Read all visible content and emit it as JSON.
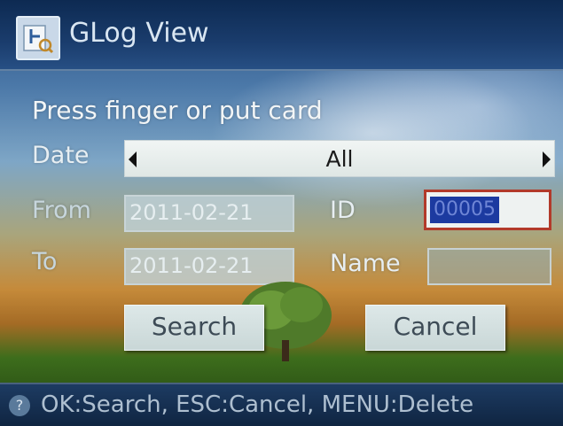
{
  "header": {
    "title": "GLog View",
    "icon": "finger-log-icon"
  },
  "form": {
    "instruction": "Press finger or put card",
    "date_label": "Date",
    "date_value": "All",
    "from_label": "From",
    "from_value": "2011-02-21",
    "to_label": "To",
    "to_value": "2011-02-21",
    "id_label": "ID",
    "id_value": "00005",
    "name_label": "Name",
    "name_value": ""
  },
  "buttons": {
    "search": "Search",
    "cancel": "Cancel"
  },
  "status": {
    "icon": "help-icon",
    "text": "OK:Search, ESC:Cancel, MENU:Delete"
  },
  "colors": {
    "accent": "#1c3aa0",
    "focus_border": "#b23a2a",
    "titlebar": "#1a3c6c"
  }
}
